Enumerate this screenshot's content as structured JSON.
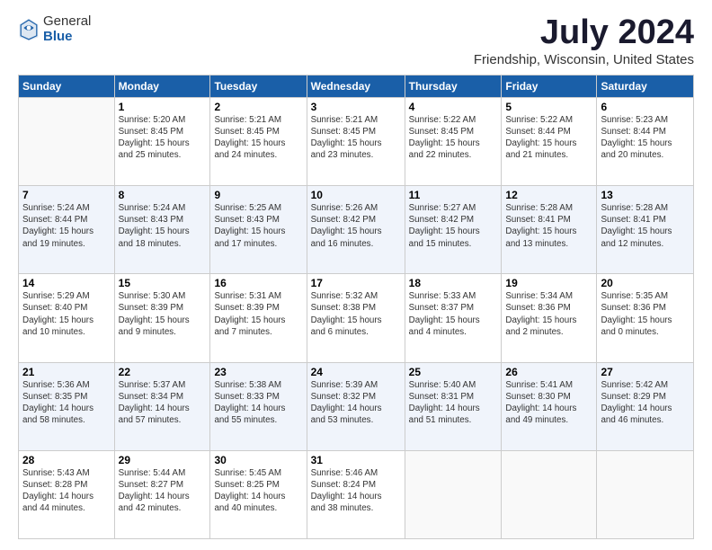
{
  "logo": {
    "general": "General",
    "blue": "Blue"
  },
  "title": "July 2024",
  "subtitle": "Friendship, Wisconsin, United States",
  "headers": [
    "Sunday",
    "Monday",
    "Tuesday",
    "Wednesday",
    "Thursday",
    "Friday",
    "Saturday"
  ],
  "weeks": [
    [
      {
        "day": "",
        "info": ""
      },
      {
        "day": "1",
        "info": "Sunrise: 5:20 AM\nSunset: 8:45 PM\nDaylight: 15 hours\nand 25 minutes."
      },
      {
        "day": "2",
        "info": "Sunrise: 5:21 AM\nSunset: 8:45 PM\nDaylight: 15 hours\nand 24 minutes."
      },
      {
        "day": "3",
        "info": "Sunrise: 5:21 AM\nSunset: 8:45 PM\nDaylight: 15 hours\nand 23 minutes."
      },
      {
        "day": "4",
        "info": "Sunrise: 5:22 AM\nSunset: 8:45 PM\nDaylight: 15 hours\nand 22 minutes."
      },
      {
        "day": "5",
        "info": "Sunrise: 5:22 AM\nSunset: 8:44 PM\nDaylight: 15 hours\nand 21 minutes."
      },
      {
        "day": "6",
        "info": "Sunrise: 5:23 AM\nSunset: 8:44 PM\nDaylight: 15 hours\nand 20 minutes."
      }
    ],
    [
      {
        "day": "7",
        "info": "Sunrise: 5:24 AM\nSunset: 8:44 PM\nDaylight: 15 hours\nand 19 minutes."
      },
      {
        "day": "8",
        "info": "Sunrise: 5:24 AM\nSunset: 8:43 PM\nDaylight: 15 hours\nand 18 minutes."
      },
      {
        "day": "9",
        "info": "Sunrise: 5:25 AM\nSunset: 8:43 PM\nDaylight: 15 hours\nand 17 minutes."
      },
      {
        "day": "10",
        "info": "Sunrise: 5:26 AM\nSunset: 8:42 PM\nDaylight: 15 hours\nand 16 minutes."
      },
      {
        "day": "11",
        "info": "Sunrise: 5:27 AM\nSunset: 8:42 PM\nDaylight: 15 hours\nand 15 minutes."
      },
      {
        "day": "12",
        "info": "Sunrise: 5:28 AM\nSunset: 8:41 PM\nDaylight: 15 hours\nand 13 minutes."
      },
      {
        "day": "13",
        "info": "Sunrise: 5:28 AM\nSunset: 8:41 PM\nDaylight: 15 hours\nand 12 minutes."
      }
    ],
    [
      {
        "day": "14",
        "info": "Sunrise: 5:29 AM\nSunset: 8:40 PM\nDaylight: 15 hours\nand 10 minutes."
      },
      {
        "day": "15",
        "info": "Sunrise: 5:30 AM\nSunset: 8:39 PM\nDaylight: 15 hours\nand 9 minutes."
      },
      {
        "day": "16",
        "info": "Sunrise: 5:31 AM\nSunset: 8:39 PM\nDaylight: 15 hours\nand 7 minutes."
      },
      {
        "day": "17",
        "info": "Sunrise: 5:32 AM\nSunset: 8:38 PM\nDaylight: 15 hours\nand 6 minutes."
      },
      {
        "day": "18",
        "info": "Sunrise: 5:33 AM\nSunset: 8:37 PM\nDaylight: 15 hours\nand 4 minutes."
      },
      {
        "day": "19",
        "info": "Sunrise: 5:34 AM\nSunset: 8:36 PM\nDaylight: 15 hours\nand 2 minutes."
      },
      {
        "day": "20",
        "info": "Sunrise: 5:35 AM\nSunset: 8:36 PM\nDaylight: 15 hours\nand 0 minutes."
      }
    ],
    [
      {
        "day": "21",
        "info": "Sunrise: 5:36 AM\nSunset: 8:35 PM\nDaylight: 14 hours\nand 58 minutes."
      },
      {
        "day": "22",
        "info": "Sunrise: 5:37 AM\nSunset: 8:34 PM\nDaylight: 14 hours\nand 57 minutes."
      },
      {
        "day": "23",
        "info": "Sunrise: 5:38 AM\nSunset: 8:33 PM\nDaylight: 14 hours\nand 55 minutes."
      },
      {
        "day": "24",
        "info": "Sunrise: 5:39 AM\nSunset: 8:32 PM\nDaylight: 14 hours\nand 53 minutes."
      },
      {
        "day": "25",
        "info": "Sunrise: 5:40 AM\nSunset: 8:31 PM\nDaylight: 14 hours\nand 51 minutes."
      },
      {
        "day": "26",
        "info": "Sunrise: 5:41 AM\nSunset: 8:30 PM\nDaylight: 14 hours\nand 49 minutes."
      },
      {
        "day": "27",
        "info": "Sunrise: 5:42 AM\nSunset: 8:29 PM\nDaylight: 14 hours\nand 46 minutes."
      }
    ],
    [
      {
        "day": "28",
        "info": "Sunrise: 5:43 AM\nSunset: 8:28 PM\nDaylight: 14 hours\nand 44 minutes."
      },
      {
        "day": "29",
        "info": "Sunrise: 5:44 AM\nSunset: 8:27 PM\nDaylight: 14 hours\nand 42 minutes."
      },
      {
        "day": "30",
        "info": "Sunrise: 5:45 AM\nSunset: 8:25 PM\nDaylight: 14 hours\nand 40 minutes."
      },
      {
        "day": "31",
        "info": "Sunrise: 5:46 AM\nSunset: 8:24 PM\nDaylight: 14 hours\nand 38 minutes."
      },
      {
        "day": "",
        "info": ""
      },
      {
        "day": "",
        "info": ""
      },
      {
        "day": "",
        "info": ""
      }
    ]
  ]
}
